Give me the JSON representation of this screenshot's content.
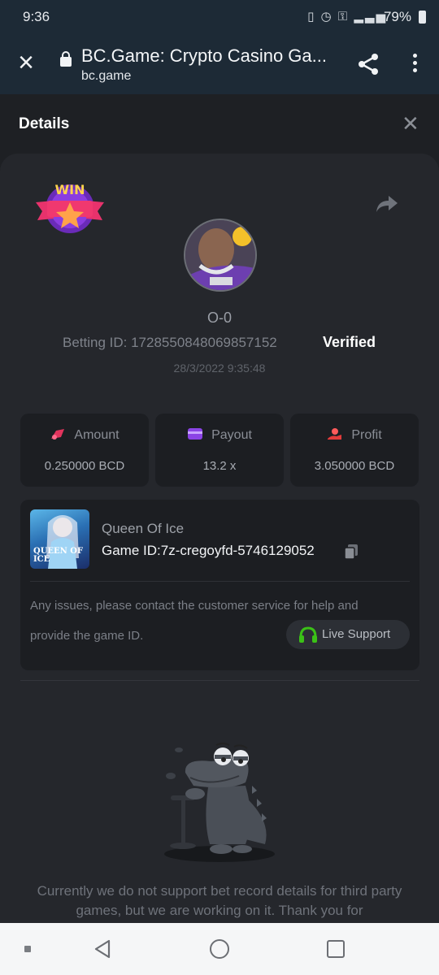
{
  "status_bar": {
    "time": "9:36",
    "battery": "79%",
    "icons": [
      "vibrate-icon",
      "alarm-icon",
      "vpn-key-icon",
      "lte-icon",
      "signal-icon",
      "battery-icon"
    ]
  },
  "browser": {
    "page_title": "BC.Game: Crypto Casino Ga...",
    "domain": "bc.game"
  },
  "details": {
    "title": "Details",
    "win_badge_text": "WIN",
    "username": "O-0",
    "betting_id": "Betting ID: 172855084806985715​2",
    "verified": "Verified",
    "timestamp": "28/3/2022 9:35:48"
  },
  "stats": [
    {
      "label": "Amount",
      "value": "0.250000 BCD",
      "icon": "amount-icon",
      "color": "#e2345d"
    },
    {
      "label": "Payout",
      "value": "13.2 x",
      "icon": "payout-card-icon",
      "color": "#8b44e6"
    },
    {
      "label": "Profit",
      "value": "3.050000 BCD",
      "icon": "profit-hand-icon",
      "color": "#e23b3b"
    }
  ],
  "game": {
    "name": "Queen Of Ice",
    "id_text": "Game ID:7z-cregoyfd-5746129052",
    "thumb_text": "QUEEN OF ICE",
    "issue_line1": "Any issues, please contact the customer service for help and",
    "issue_line2": "provide the game ID.",
    "support_label": "Live Support"
  },
  "footer": {
    "message": "Currently we do not support bet record details for third party games, but we are working on it. Thank you for"
  },
  "colors": {
    "background": "#1e2024",
    "card": "#25272c",
    "accent_green": "#3bc117"
  }
}
